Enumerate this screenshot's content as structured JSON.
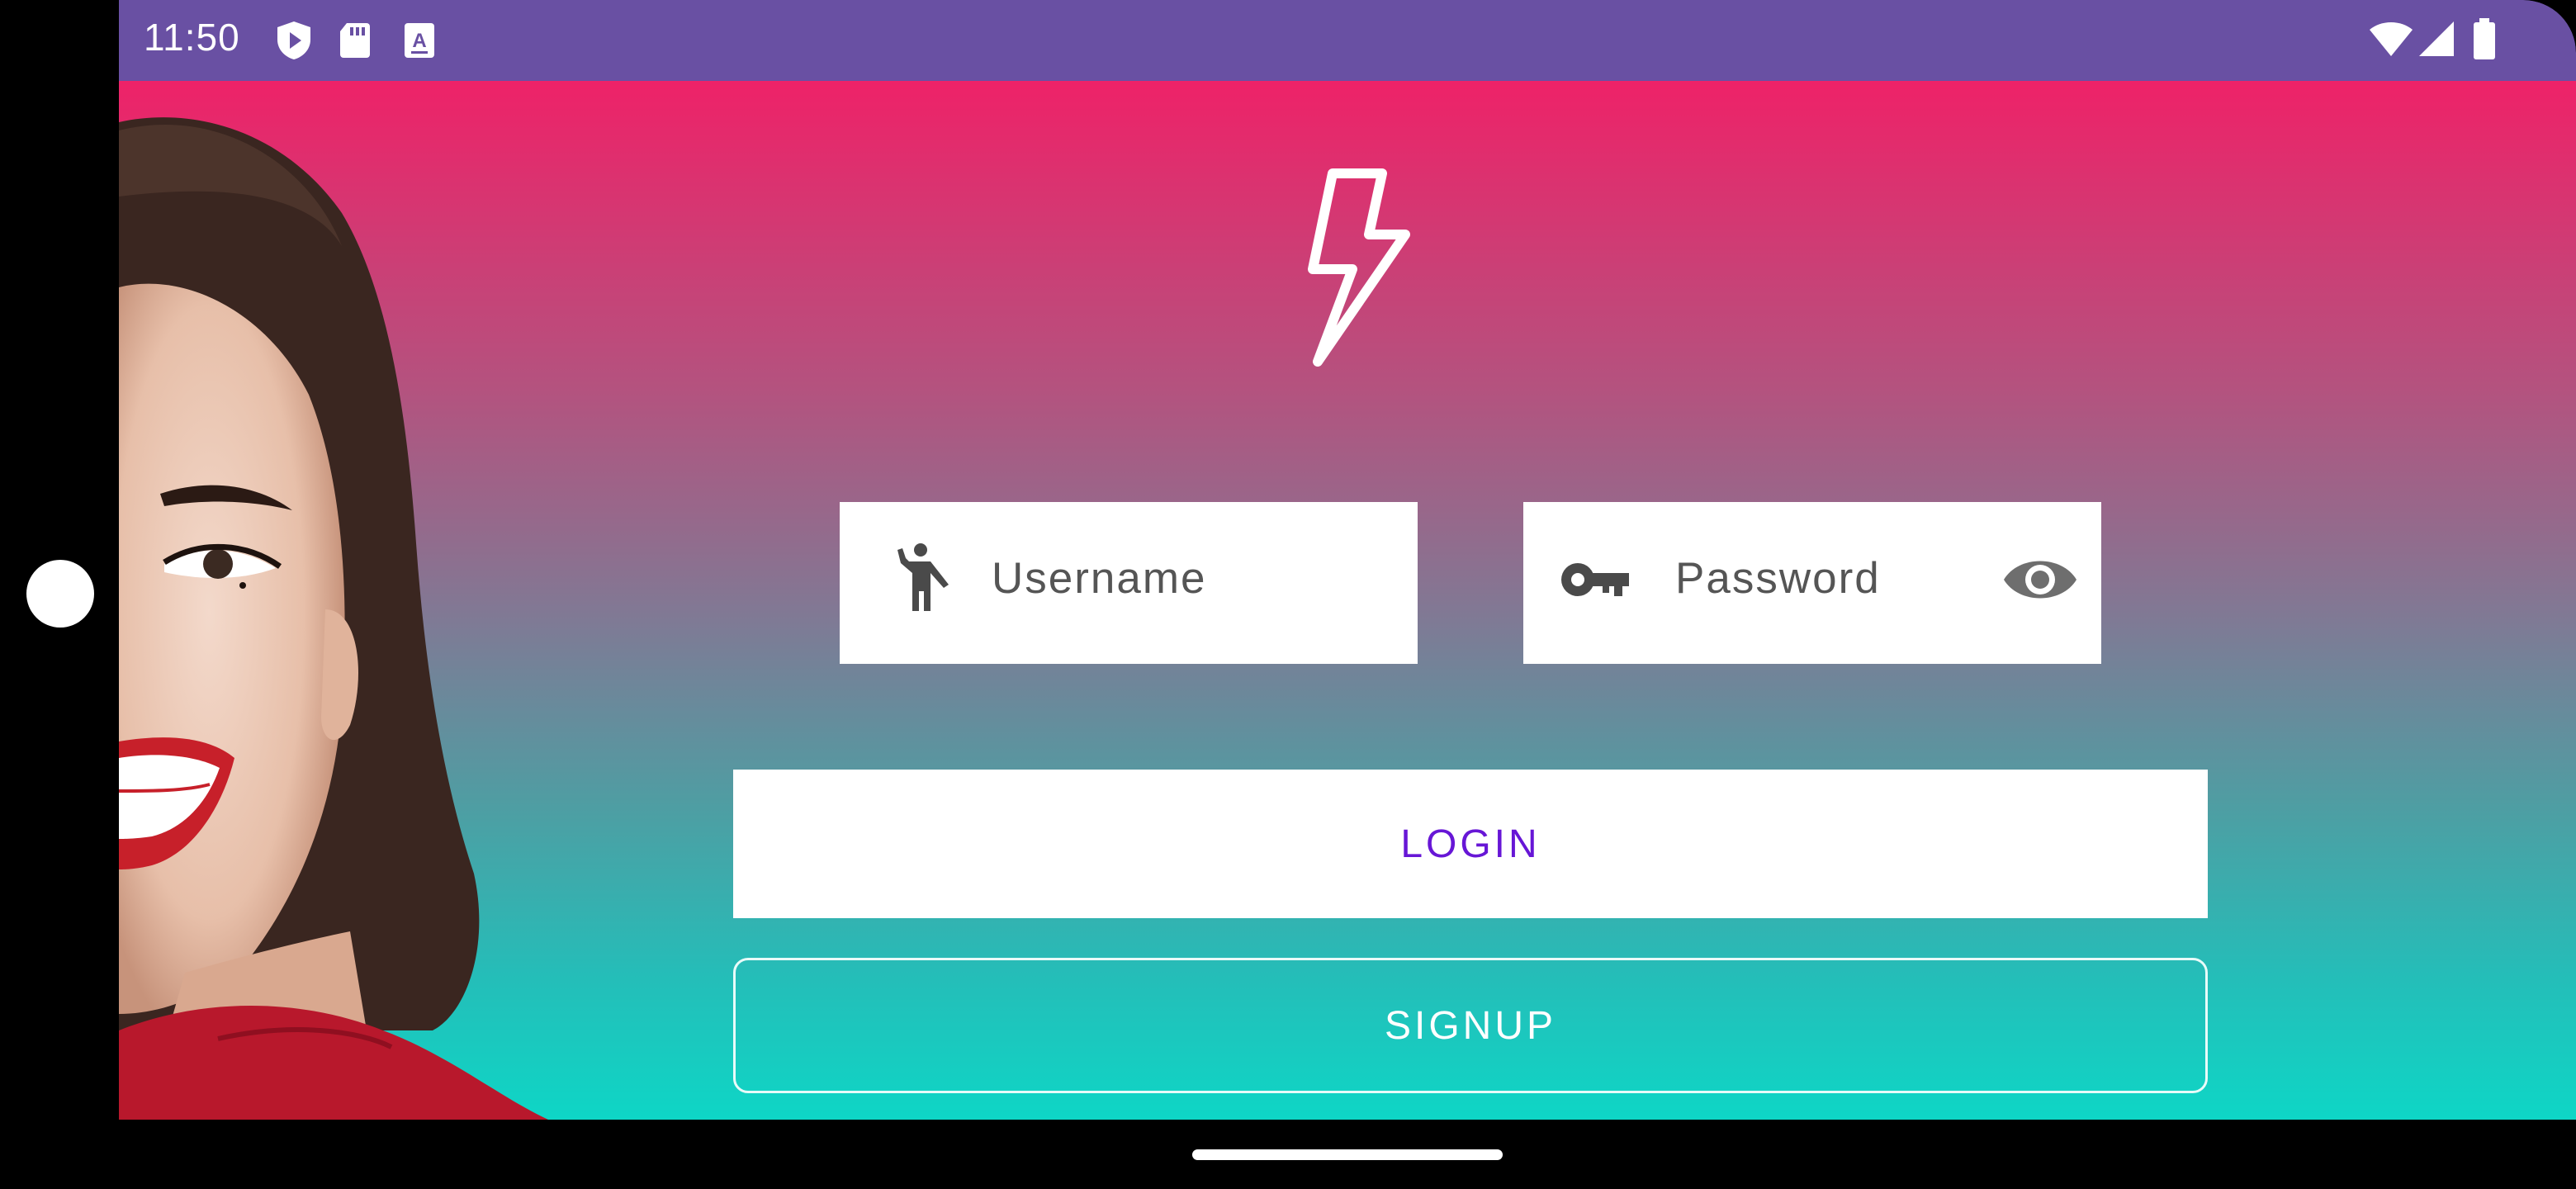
{
  "status_bar": {
    "time": "11:50",
    "left_icons": [
      "play-protect-icon",
      "sd-card-icon",
      "font-download-icon"
    ],
    "right_icons": [
      "wifi-icon",
      "cell-signal-icon",
      "battery-icon"
    ]
  },
  "logo": {
    "icon": "lightning-bolt-icon"
  },
  "form": {
    "username": {
      "placeholder": "Username",
      "icon": "waving-person-icon"
    },
    "password": {
      "placeholder": "Password",
      "icon": "key-icon",
      "toggle_icon": "eye-icon"
    }
  },
  "buttons": {
    "login": "LOGIN",
    "signup": "SIGNUP"
  },
  "colors": {
    "status_bar": "#6950a3",
    "gradient_top": "#ee2268",
    "gradient_bottom": "#0ed6c6",
    "login_text": "#6716d6"
  }
}
